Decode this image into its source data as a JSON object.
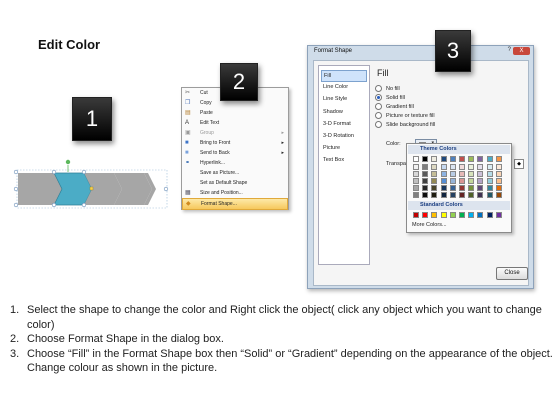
{
  "title": "Edit Color",
  "steps": [
    "1",
    "2",
    "3"
  ],
  "context_menu": {
    "items": [
      {
        "label": "Cut",
        "icon": "scissors-icon",
        "glyph": "✂",
        "color": "#666"
      },
      {
        "label": "Copy",
        "icon": "copy-icon",
        "glyph": "❐",
        "color": "#4a6fb5"
      },
      {
        "label": "Paste",
        "icon": "paste-icon",
        "glyph": "▤",
        "color": "#b27b2a"
      },
      {
        "label": "Edit Text",
        "icon": "text-icon",
        "glyph": "A",
        "color": "#333"
      },
      {
        "label": "Group",
        "icon": "group-icon",
        "glyph": "▣",
        "color": "#999",
        "dim": true,
        "submenu": true
      },
      {
        "label": "Bring to Front",
        "icon": "bring-front-icon",
        "glyph": "■",
        "color": "#3d74c8",
        "submenu": true
      },
      {
        "label": "Send to Back",
        "icon": "send-back-icon",
        "glyph": "■",
        "color": "#7aa2dd",
        "submenu": true
      },
      {
        "label": "Hyperlink...",
        "icon": "hyperlink-icon",
        "glyph": "⚭",
        "color": "#3a6fb5"
      },
      {
        "label": "Save as Picture...",
        "icon": "",
        "glyph": "",
        "color": "#333"
      },
      {
        "label": "Set as Default Shape",
        "icon": "",
        "glyph": "",
        "color": "#333"
      },
      {
        "label": "Size and Position...",
        "icon": "size-icon",
        "glyph": "▦",
        "color": "#556"
      },
      {
        "label": "Format Shape...",
        "icon": "format-shape-icon",
        "glyph": "◆",
        "color": "#d08a1e",
        "highlighted": true
      }
    ]
  },
  "dialog": {
    "title": "Format Shape",
    "help": "?",
    "close_x": "X",
    "nav": [
      "Fill",
      "Line Color",
      "Line Style",
      "Shadow",
      "3-D Format",
      "3-D Rotation",
      "Picture",
      "Text Box"
    ],
    "heading": "Fill",
    "options": [
      "No fill",
      "Solid fill",
      "Gradient fill",
      "Picture or texture fill",
      "Slide background fill"
    ],
    "selected_option": "Solid fill",
    "color_label": "Color:",
    "transparency_label": "Transparency:",
    "close_button": "Close"
  },
  "palette": {
    "theme_header": "Theme Colors",
    "standard_header": "Standard Colors",
    "more": "More Colors...",
    "theme_top": [
      "#ffffff",
      "#000000",
      "#eeece1",
      "#1f497d",
      "#4f81bd",
      "#c0504d",
      "#9bbb59",
      "#8064a2",
      "#4bacc6",
      "#f79646"
    ],
    "theme_shades": [
      [
        "#f2f2f2",
        "#7f7f7f",
        "#ddd9c3",
        "#c6d9f0",
        "#dbe5f1",
        "#f2dcdb",
        "#ebf1dd",
        "#e5e0ec",
        "#dbeef3",
        "#fdeada"
      ],
      [
        "#d8d8d8",
        "#595959",
        "#c4bd97",
        "#8db3e2",
        "#b8cce4",
        "#e5b9b7",
        "#d7e3bc",
        "#ccc1d9",
        "#b7dde8",
        "#fbd5b5"
      ],
      [
        "#bfbfbf",
        "#3f3f3f",
        "#938953",
        "#548dd4",
        "#95b3d7",
        "#d99694",
        "#c3d69b",
        "#b2a2c7",
        "#92cddc",
        "#fac08f"
      ],
      [
        "#a5a5a5",
        "#262626",
        "#494429",
        "#17365d",
        "#366092",
        "#953734",
        "#76923c",
        "#5f497a",
        "#31859b",
        "#e36c09"
      ],
      [
        "#7f7f7f",
        "#0c0c0c",
        "#1d1b10",
        "#0f243e",
        "#244061",
        "#632423",
        "#4f6128",
        "#3f3151",
        "#205867",
        "#974806"
      ]
    ],
    "standard": [
      "#c00000",
      "#ff0000",
      "#ffc000",
      "#ffff00",
      "#92d050",
      "#00b050",
      "#00b0f0",
      "#0070c0",
      "#002060",
      "#7030a0"
    ]
  },
  "instructions": [
    {
      "num": "1.",
      "text": "Select the shape to change the color and Right click the object( click any object which you want to change color)"
    },
    {
      "num": "2.",
      "text": "Choose Format Shape in the dialog box."
    },
    {
      "num": "3.",
      "text": "Choose “Fill” in the Format Shape box then “Solid” or “Gradient” depending on the appearance of the object. Change colour as shown in the picture."
    }
  ],
  "colors": {
    "arrow_gray": "#a6a6a6",
    "arrow_selected": "#4bacc6",
    "selection_handle": "#5cb85c"
  }
}
